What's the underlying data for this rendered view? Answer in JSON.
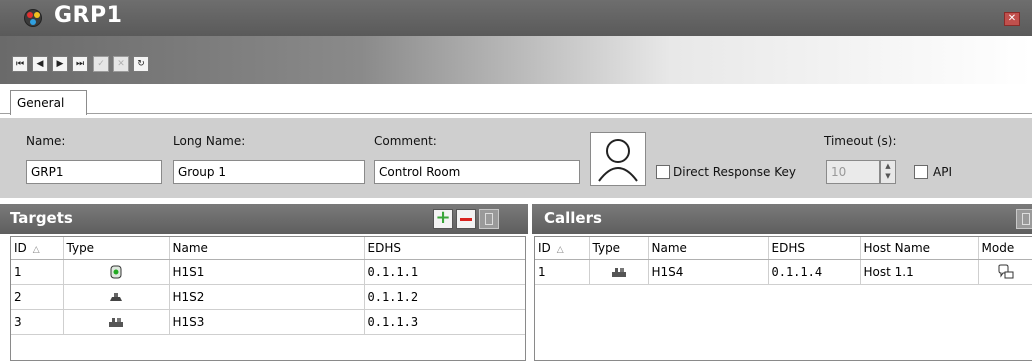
{
  "window": {
    "title": "GRP1",
    "close_glyph": "✕",
    "app_icon": "group-app-icon"
  },
  "toolbar": {
    "first_glyph": "⏮",
    "prev_glyph": "◀",
    "next_glyph": "▶",
    "last_glyph": "⏭",
    "apply_glyph": "✓",
    "cancel_glyph": "✕",
    "refresh_glyph": "↻"
  },
  "tabs": [
    {
      "label": "General"
    }
  ],
  "form": {
    "name_label": "Name:",
    "name_value": "GRP1",
    "long_name_label": "Long Name:",
    "long_name_value": "Group 1",
    "comment_label": "Comment:",
    "comment_value": "Control Room",
    "direct_response_label": "Direct Response Key",
    "timeout_label": "Timeout (s):",
    "timeout_value": "10",
    "api_label": "API"
  },
  "targets": {
    "title": "Targets",
    "columns": [
      "ID",
      "Type",
      "Name",
      "EDHS"
    ],
    "rows": [
      {
        "id": "1",
        "type_icon": "panel-icon",
        "name": "H1S1",
        "edhs": "0.1.1.1"
      },
      {
        "id": "2",
        "type_icon": "desk-station-icon",
        "name": "H1S2",
        "edhs": "0.1.1.2"
      },
      {
        "id": "3",
        "type_icon": "keyboard-station-icon",
        "name": "H1S3",
        "edhs": "0.1.1.3"
      }
    ]
  },
  "callers": {
    "title": "Callers",
    "columns": [
      "ID",
      "Type",
      "Name",
      "EDHS",
      "Host Name",
      "Mode"
    ],
    "rows": [
      {
        "id": "1",
        "type_icon": "keyboard-station-icon",
        "name": "H1S4",
        "edhs": "0.1.1.4",
        "host": "Host 1.1",
        "mode_icon": "talk-mode-icon"
      }
    ]
  },
  "colors": {
    "titlebar": "#5f5f5f",
    "form_bg": "#cfcfcf",
    "add_green": "#3aa53a",
    "remove_red": "#d9231f",
    "close_red": "#c0504d"
  }
}
